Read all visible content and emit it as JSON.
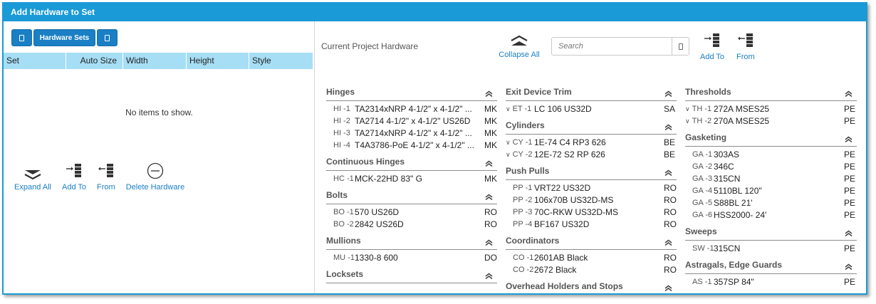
{
  "window": {
    "title": "Add Hardware to Set"
  },
  "left_toolbar": {
    "hardware_sets_label": "Hardware Sets"
  },
  "grid": {
    "columns": [
      "Set",
      "Auto Size",
      "Width",
      "Height",
      "Style"
    ],
    "empty_text": "No items to show."
  },
  "left_actions": {
    "expand_all": "Expand All",
    "add_to": "Add To",
    "from": "From",
    "delete_hardware": "Delete Hardware"
  },
  "right_header": {
    "title": "Current Project Hardware",
    "collapse_all": "Collapse All",
    "search_placeholder": "Search",
    "add_to": "Add To",
    "from": "From"
  },
  "columns": [
    [
      {
        "name": "Hinges",
        "items": [
          {
            "code": "HI -1",
            "desc": "TA2314xNRP 4-1/2\" x 4-1/2\" ...",
            "mfr": "MK"
          },
          {
            "code": "HI -2",
            "desc": "TA2714 4-1/2\" x 4-1/2\" US26D",
            "mfr": "MK"
          },
          {
            "code": "HI -3",
            "desc": "TA2714xNRP 4-1/2\" x 4-1/2\" ...",
            "mfr": "MK"
          },
          {
            "code": "HI -4",
            "desc": "T4A3786-PoE 4-1/2\" x 4-1/2\" ...",
            "mfr": "MK"
          }
        ]
      },
      {
        "name": "Continuous Hinges",
        "items": [
          {
            "code": "HC -1",
            "desc": "MCK-22HD 83\" G",
            "mfr": "MK"
          }
        ]
      },
      {
        "name": "Bolts",
        "items": [
          {
            "code": "BO -1",
            "desc": "570 US26D",
            "mfr": "RO"
          },
          {
            "code": "BO -2",
            "desc": "2842 US26D",
            "mfr": "RO"
          }
        ]
      },
      {
        "name": "Mullions",
        "items": [
          {
            "code": "MU -1",
            "desc": "1330-8 600",
            "mfr": "DO"
          }
        ]
      },
      {
        "name": "Locksets",
        "items": []
      }
    ],
    [
      {
        "name": "Exit Device Trim",
        "items": [
          {
            "code": "ET -1",
            "desc": "LC 106 US32D",
            "mfr": "SA",
            "expandable": true
          }
        ]
      },
      {
        "name": "Cylinders",
        "items": [
          {
            "code": "CY -1",
            "desc": "1E-74 C4 RP3 626",
            "mfr": "BE",
            "expandable": true
          },
          {
            "code": "CY -2",
            "desc": "12E-72 S2 RP 626",
            "mfr": "BE",
            "expandable": true
          }
        ]
      },
      {
        "name": "Push Pulls",
        "items": [
          {
            "code": "PP -1",
            "desc": "VRT22 US32D",
            "mfr": "RO"
          },
          {
            "code": "PP -2",
            "desc": "106x70B US32D-MS",
            "mfr": "RO"
          },
          {
            "code": "PP -3",
            "desc": "70C-RKW US32D-MS",
            "mfr": "RO"
          },
          {
            "code": "PP -4",
            "desc": "BF167 US32D",
            "mfr": "RO"
          }
        ]
      },
      {
        "name": "Coordinators",
        "items": [
          {
            "code": "CO -1",
            "desc": "2601AB Black",
            "mfr": "RO"
          },
          {
            "code": "CO -2",
            "desc": "2672 Black",
            "mfr": "RO"
          }
        ]
      },
      {
        "name": "Overhead Holders and Stops",
        "items": []
      }
    ],
    [
      {
        "name": "Thresholds",
        "items": [
          {
            "code": "TH -1",
            "desc": "272A MSES25",
            "mfr": "PE",
            "expandable": true
          },
          {
            "code": "TH -2",
            "desc": "270A MSES25",
            "mfr": "PE",
            "expandable": true
          }
        ]
      },
      {
        "name": "Gasketing",
        "items": [
          {
            "code": "GA -1",
            "desc": "303AS",
            "mfr": "PE"
          },
          {
            "code": "GA -2",
            "desc": "346C",
            "mfr": "PE"
          },
          {
            "code": "GA -3",
            "desc": "315CN",
            "mfr": "PE"
          },
          {
            "code": "GA -4",
            "desc": "5110BL 120\"",
            "mfr": "PE"
          },
          {
            "code": "GA -5",
            "desc": "S88BL 21'",
            "mfr": "PE"
          },
          {
            "code": "GA -6",
            "desc": "HSS2000- 24'",
            "mfr": "PE"
          }
        ]
      },
      {
        "name": "Sweeps",
        "items": [
          {
            "code": "SW -1",
            "desc": "315CN",
            "mfr": "PE"
          }
        ]
      },
      {
        "name": "Astragals, Edge Guards",
        "items": [
          {
            "code": "AS -1",
            "desc": "357SP 84\"",
            "mfr": "PE"
          }
        ]
      }
    ]
  ],
  "colors": {
    "accent": "#1a9ad6",
    "button": "#1a7fc4",
    "grid_header": "#a6def5",
    "link": "#1a7fc4"
  }
}
